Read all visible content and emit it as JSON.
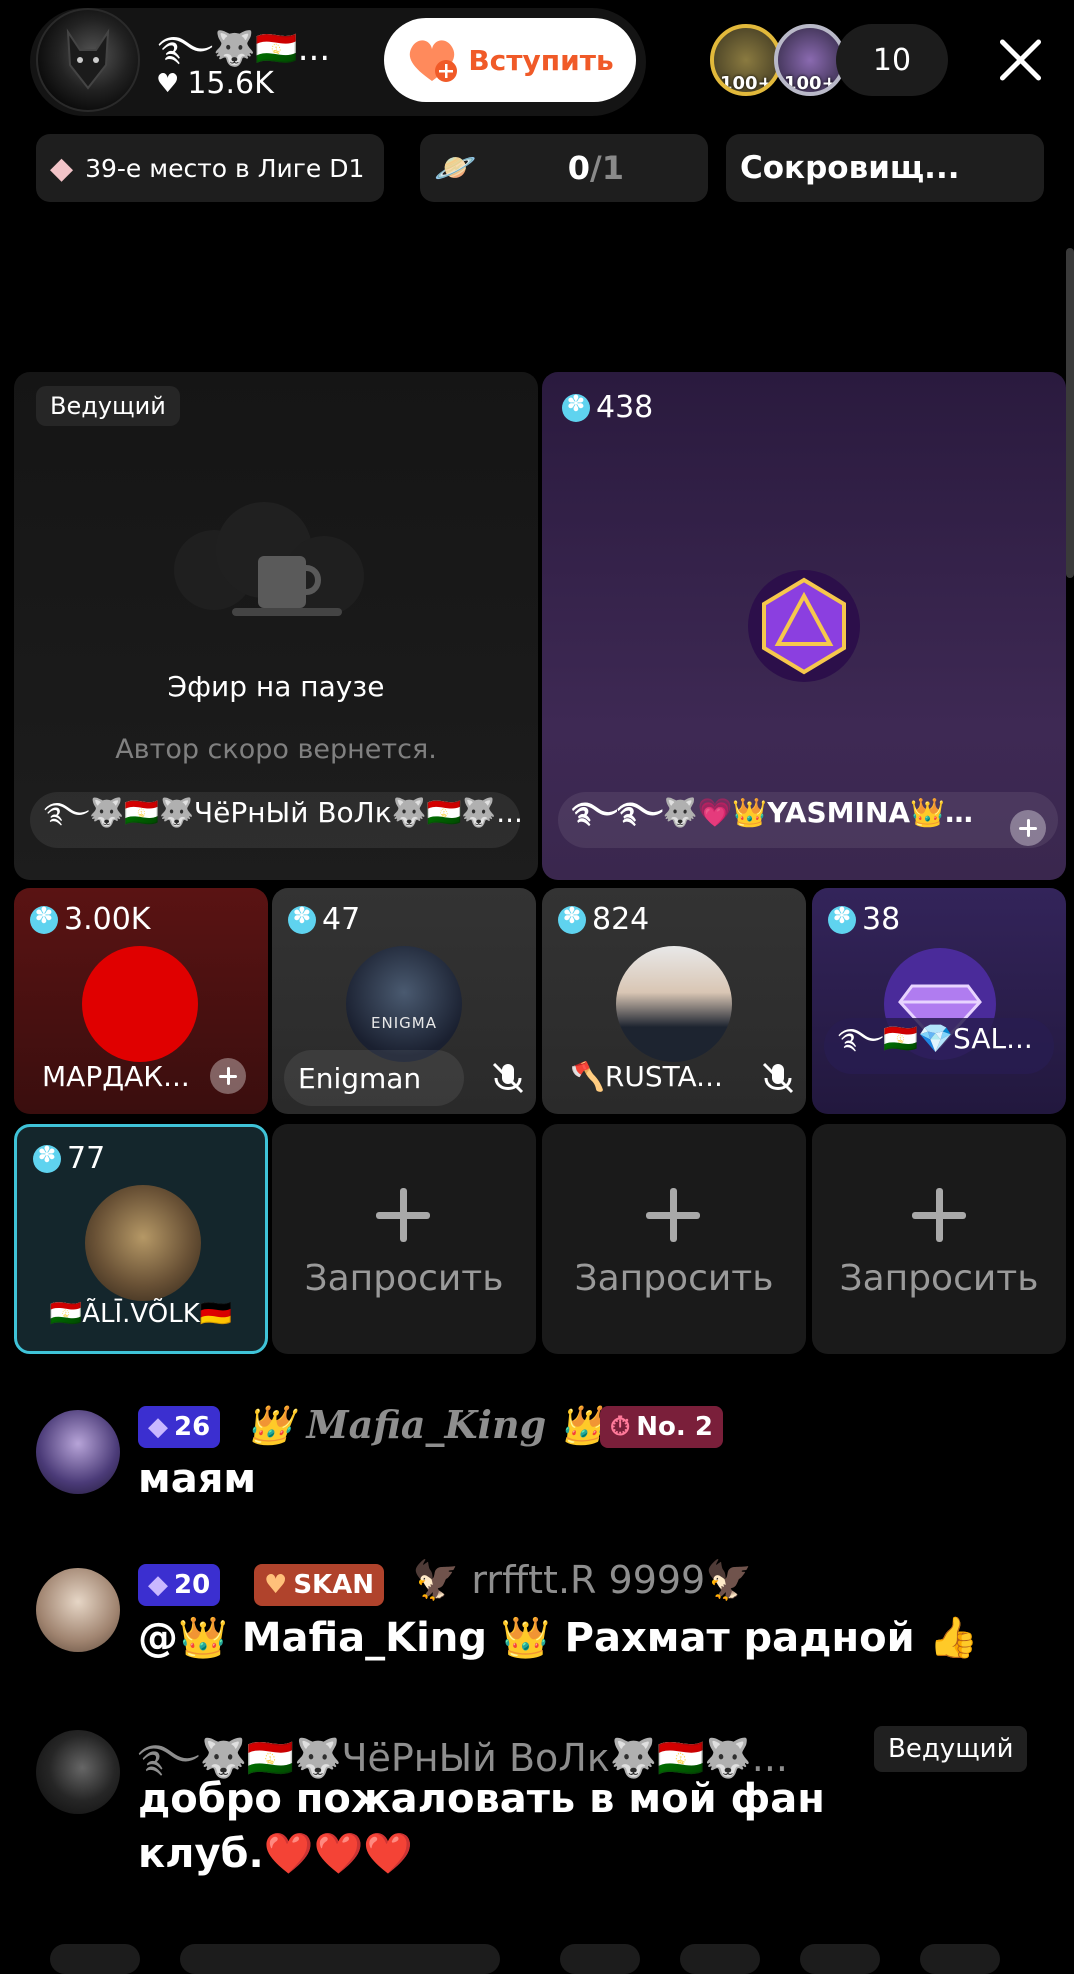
{
  "header": {
    "host_name": "࿐🐺🇹🇯...",
    "likes": "15.6K",
    "join_label": "Вступить",
    "viewer_badges": [
      "100+",
      "100+"
    ],
    "viewer_count": "10"
  },
  "chips": {
    "league": "39-е место в Лиге D1",
    "progress_done": "0",
    "progress_total": "/1",
    "treasure": "Сокровищ..."
  },
  "stage": {
    "host_tile": {
      "tag": "Ведущий",
      "paused_title": "Эфир на паузе",
      "paused_sub": "Автор скоро вернется.",
      "name": "࿐🐺🇹🇯🐺ЧёРнЫй ВоЛк🐺🇹🇯🐺..."
    },
    "yasmina_tile": {
      "score": "438",
      "name": "࿐࿐🐺💗👑YASMINA👑💗..."
    },
    "guests": [
      {
        "score": "3.00K",
        "name": "МАРДАК..."
      },
      {
        "score": "47",
        "name": "Enigman",
        "avatar_text": "ENIGMA"
      },
      {
        "score": "824",
        "name": "🪓RUSTA..."
      },
      {
        "score": "38",
        "name": "࿐🇹🇯💎SAL..."
      },
      {
        "score": "77",
        "name": "🇹🇯ÃLĪ.VÕLK🇩🇪"
      }
    ],
    "request_label": "Запросить"
  },
  "chat": [
    {
      "level": "26",
      "name": "👑 Mafia_King 👑",
      "rank": "No. 2",
      "message": "маям"
    },
    {
      "level": "20",
      "tag": "SKAN",
      "name": "🦅 rrfftt.R 9999🦅",
      "message": "@👑 Mafia_King 👑 Рахмат радной 👍"
    },
    {
      "name": "࿐🐺🇹🇯🐺ЧёРнЫй ВоЛк🐺🇹🇯🐺...",
      "role": "Ведущий",
      "message_line1": "добро пожаловать в мой фан",
      "message_line2": "клуб.❤️❤️❤️"
    }
  ],
  "colors": {
    "accent_orange": "#f05a28",
    "score_blue": "#5fd3ef",
    "selected_border": "#3fc3d8",
    "level_purple": "#3b2fd0",
    "rank_red": "#7a1f3a"
  }
}
